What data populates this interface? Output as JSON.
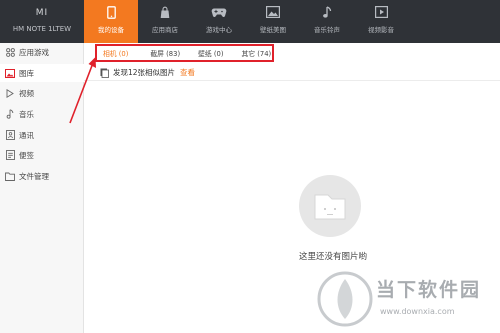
{
  "device": {
    "brand": "MI",
    "model": "HM NOTE 1LTEW"
  },
  "nav_tabs": [
    {
      "label": "我的设备",
      "icon": "phone-icon"
    },
    {
      "label": "应用商店",
      "icon": "shopping-bag-icon"
    },
    {
      "label": "游戏中心",
      "icon": "gamepad-icon"
    },
    {
      "label": "壁纸美图",
      "icon": "image-icon"
    },
    {
      "label": "音乐铃声",
      "icon": "music-note-icon"
    },
    {
      "label": "视频影音",
      "icon": "video-play-icon"
    }
  ],
  "sidebar": {
    "items": [
      {
        "label": "应用游戏",
        "icon": "apps-grid-icon"
      },
      {
        "label": "图库",
        "icon": "gallery-icon"
      },
      {
        "label": "视频",
        "icon": "play-icon"
      },
      {
        "label": "音乐",
        "icon": "music-note-icon"
      },
      {
        "label": "通讯",
        "icon": "contacts-icon"
      },
      {
        "label": "便签",
        "icon": "notes-icon"
      },
      {
        "label": "文件管理",
        "icon": "folder-icon"
      }
    ]
  },
  "filters": [
    {
      "label": "相机 (0)"
    },
    {
      "label": "截屏 (83)"
    },
    {
      "label": "壁纸 (0)"
    },
    {
      "label": "其它 (74)"
    }
  ],
  "notice": {
    "text": "发现12张相似图片",
    "link": "查看"
  },
  "empty": {
    "text": "这里还没有图片哟"
  },
  "watermark": {
    "name": "当下软件园",
    "url": "www.downxia.com"
  },
  "colors": {
    "accent": "#f37920",
    "topbar": "#2f3237",
    "highlight_box": "#e0212b"
  }
}
